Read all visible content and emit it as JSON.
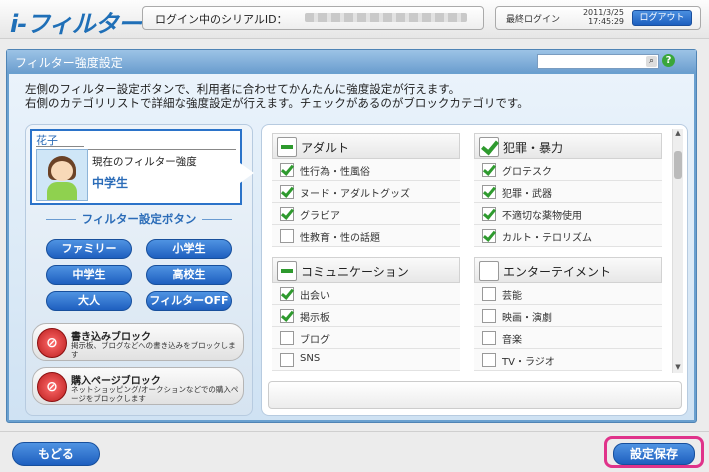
{
  "header": {
    "logo": "i-フィルター",
    "serial_label": "ログイン中のシリアルID：",
    "last_login_label": "最終ログイン",
    "last_login_date": "2011/3/25",
    "last_login_time": "17:45:29",
    "logout_label": "ログアウト"
  },
  "panel": {
    "title": "フィルター強度設定",
    "help": "?",
    "description_line1": "左側のフィルター設定ボタンで、利用者に合わせてかんたんに強度設定が行えます。",
    "description_line2": "右側のカテゴリリストで詳細な強度設定が行えます。チェックがあるのがブロックカテゴリです。"
  },
  "user": {
    "name": "花子",
    "current_strength_label": "現在のフィルター強度",
    "current_strength": "中学生"
  },
  "filter_buttons": {
    "heading": "フィルター設定ボタン",
    "items": [
      "ファミリー",
      "小学生",
      "中学生",
      "高校生",
      "大人",
      "フィルターOFF"
    ]
  },
  "blocks": [
    {
      "title": "書き込みブロック",
      "desc": "掲示板、ブログなどへの書き込みをブロックします"
    },
    {
      "title": "購入ページブロック",
      "desc": "ネットショッピング/オークションなどでの購入ページをブロックします"
    }
  ],
  "categories": [
    {
      "title": "アダルト",
      "state": "partial",
      "items": [
        {
          "label": "性行為・性風俗",
          "checked": true
        },
        {
          "label": "ヌード・アダルトグッズ",
          "checked": true
        },
        {
          "label": "グラビア",
          "checked": true
        },
        {
          "label": "性教育・性の話題",
          "checked": false
        }
      ]
    },
    {
      "title": "犯罪・暴力",
      "state": "full",
      "items": [
        {
          "label": "グロテスク",
          "checked": true
        },
        {
          "label": "犯罪・武器",
          "checked": true
        },
        {
          "label": "不適切な薬物使用",
          "checked": true
        },
        {
          "label": "カルト・テロリズム",
          "checked": true
        }
      ]
    },
    {
      "title": "コミュニケーション",
      "state": "partial",
      "items": [
        {
          "label": "出会い",
          "checked": true
        },
        {
          "label": "掲示板",
          "checked": true
        },
        {
          "label": "ブログ",
          "checked": false
        },
        {
          "label": "SNS",
          "checked": false
        }
      ]
    },
    {
      "title": "エンターテイメント",
      "state": "none",
      "items": [
        {
          "label": "芸能",
          "checked": false
        },
        {
          "label": "映画・演劇",
          "checked": false
        },
        {
          "label": "音楽",
          "checked": false
        },
        {
          "label": "TV・ラジオ",
          "checked": false
        }
      ]
    }
  ],
  "footer": {
    "back_label": "もどる",
    "save_label": "設定保存"
  },
  "colors": {
    "accent": "#1e5fbf",
    "check": "#2e9a2e",
    "highlight": "#e0338a",
    "panel": "#6aa0cf"
  }
}
